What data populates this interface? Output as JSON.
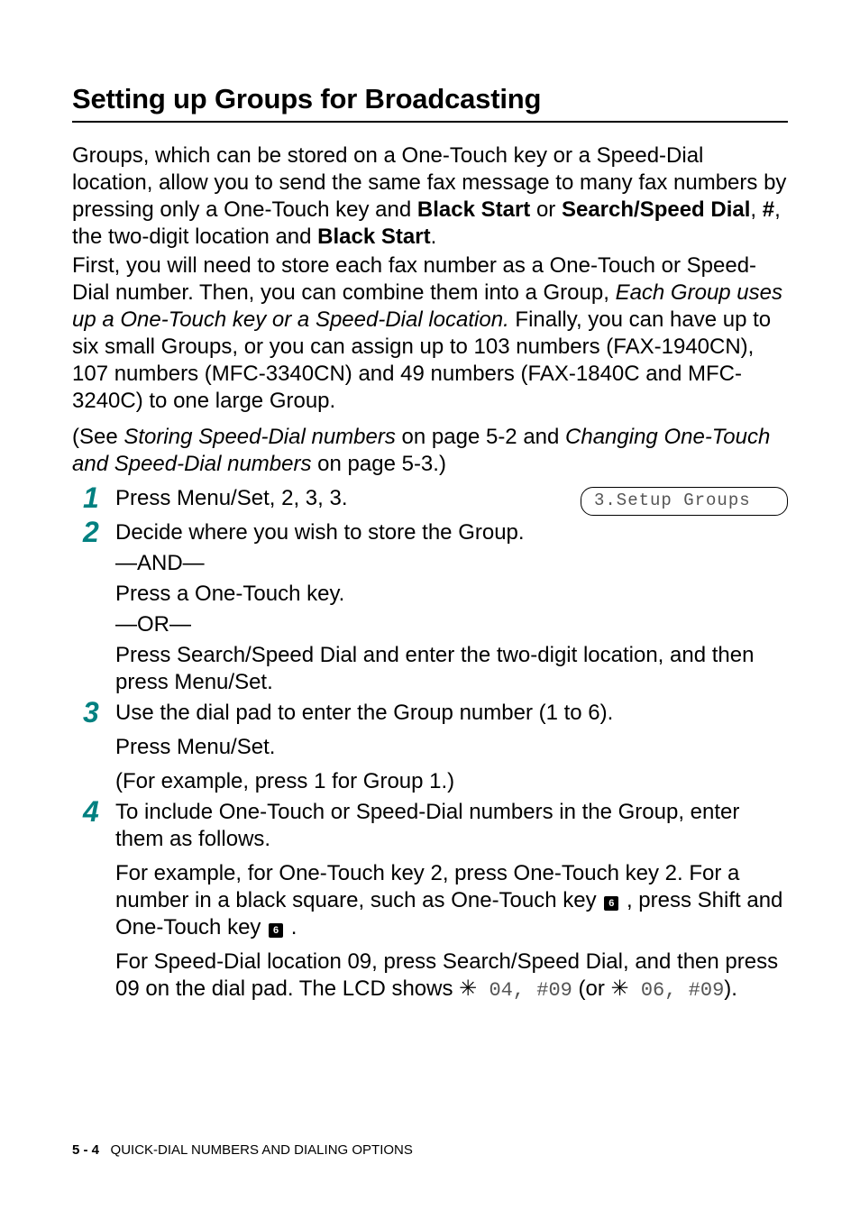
{
  "heading": "Setting up Groups for Broadcasting",
  "intro": {
    "p1a": "Groups, which can be stored on a One-Touch key or a Speed-Dial location, allow you to send the same fax message to many fax numbers by pressing only a One-Touch key and ",
    "p1b": "Black Start",
    "p1c": " or ",
    "p1d": "Search/Speed Dial",
    "p1e": ", ",
    "p1f": "#",
    "p1g": ", the two-digit location and ",
    "p1h": "Black Start",
    "p1i": ".",
    "p2a": "First, you will need to store each fax number as a One-Touch or Speed-Dial number. Then, you can combine them into a Group, ",
    "p2b": "Each Group uses up a One-Touch key or a Speed-Dial location.",
    "p2c": " Finally, you can have up to six small Groups, or you can assign up to 103 numbers (FAX-1940CN), 107 numbers (MFC-3340CN) and 49 numbers (FAX-1840C and MFC-3240C) to one large Group.",
    "p3a": "(See ",
    "p3b": "Storing Speed-Dial numbers",
    "p3c": " on page 5-2 and ",
    "p3d": "Changing One-Touch and Speed-Dial numbers",
    "p3e": " on page 5-3.)"
  },
  "lcd": "3.Setup Groups",
  "steps": {
    "s1": {
      "num": "1",
      "a": "Press ",
      "b": "Menu/Set",
      "c": ", ",
      "d": "2",
      "e": ", ",
      "f": "3",
      "g": ", ",
      "h": "3",
      "i": "."
    },
    "s2": {
      "num": "2",
      "line1": "Decide where you wish to store the Group.",
      "and": "—AND—",
      "line2": "Press a One-Touch key.",
      "or": "—OR—",
      "line3a": "Press ",
      "line3b": "Search/Speed Dial",
      "line3c": " and enter the two-digit location, and then press ",
      "line3d": "Menu/Set",
      "line3e": "."
    },
    "s3": {
      "num": "3",
      "line1": "Use the dial pad to enter the Group number (1 to 6).",
      "line2a": "Press ",
      "line2b": "Menu/Set",
      "line2c": ".",
      "line3a": "(For example, press ",
      "line3b": "1",
      "line3c": " for Group 1.)"
    },
    "s4": {
      "num": "4",
      "line1": "To include One-Touch or Speed-Dial numbers in the Group, enter them as follows.",
      "line2a": "For example, for One-Touch key ",
      "line2b": "2",
      "line2c": ", press One-Touch key ",
      "line2d": "2",
      "line2e": ". For a number in a black square, such as One-Touch key ",
      "key6": "6",
      "line2f": " , press ",
      "line2g": "Shift",
      "line2h": " and One-Touch key ",
      "line2i": " .",
      "line3a": "For Speed-Dial location 09, press ",
      "line3b": "Search/Speed Dial",
      "line3c": ", and then press ",
      "line3d": "09",
      "line3e": " on the dial pad. The LCD shows ",
      "line3f": "04, #09",
      "line3g": " (or ",
      "line3h": "06, #09",
      "line3i": ")."
    }
  },
  "footer": {
    "page": "5 - 4",
    "section": "QUICK-DIAL NUMBERS AND DIALING OPTIONS"
  }
}
